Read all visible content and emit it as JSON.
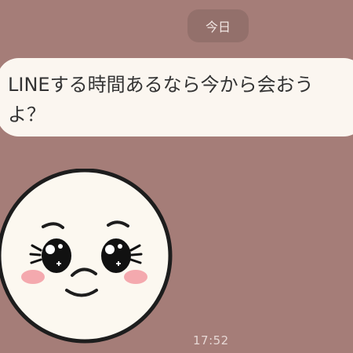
{
  "date_separator": "今日",
  "message": {
    "line1": "LINEする時間あるなら今から会おう",
    "line2": "よ？"
  },
  "sticker": {
    "icon": "pleading-face-sticker-icon"
  },
  "timestamp": "17:52",
  "colors": {
    "background": "#a57d78",
    "bubble": "#fbf6f0",
    "date_pill": "#93706b",
    "blush": "#f4a9ae"
  }
}
